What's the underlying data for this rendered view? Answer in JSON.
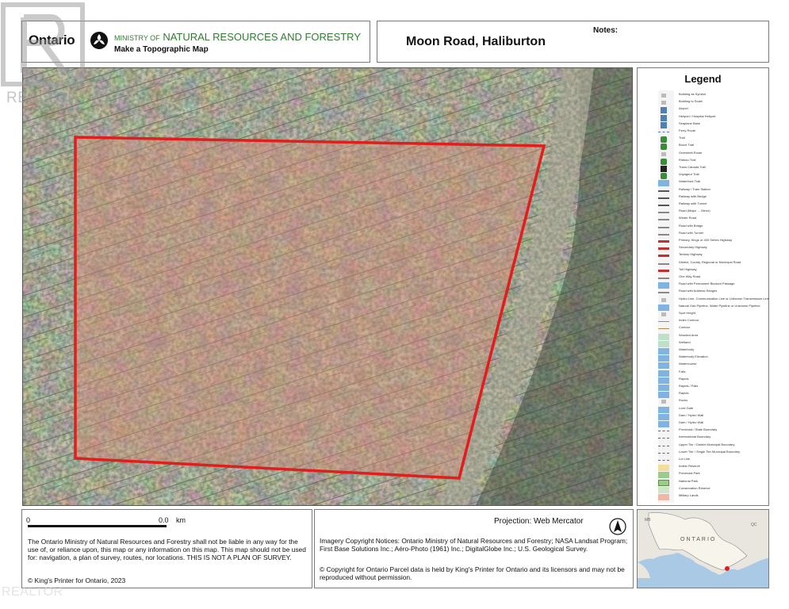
{
  "header": {
    "logo_text": "Ontario",
    "ministry_prefix": "MINISTRY OF",
    "ministry_name": "NATURAL RESOURCES AND FORESTRY",
    "subtitle": "Make a Topographic Map",
    "map_title": "Moon Road, Haliburton",
    "notes_label": "Notes:"
  },
  "legend": {
    "title": "Legend",
    "items": [
      "Building as Symbol",
      "Building to Scale",
      "Airport",
      "Heliport / Hospital Heliport",
      "Seaplane Base",
      "Ferry Route",
      "Trail",
      "Bruce Trail",
      "Greenbelt Route",
      "Rideau Trail",
      "Trans Canada Trail",
      "Voyageur Trail",
      "Waterfront Trail",
      "Railway / Train Station",
      "Railway with Bridge",
      "Railway with Tunnel",
      "Road (Major → Minor)",
      "Winter Road",
      "Road with Bridge",
      "Road with Tunnel",
      "Primary, Kings or 400 Series Highway",
      "Secondary Highway",
      "Tertiary Highway",
      "District, County, Regional or Municipal Road",
      "Toll Highway",
      "One Way Road",
      "Road with Permanent Blocked Passage",
      "Road with Address Ranges",
      "Hydro Line, Communication Line or Unknown Transmission Line",
      "Natural Gas Pipeline, Water Pipeline or Unknown Pipeline",
      "Spot Height",
      "Index Contour",
      "Contour",
      "Wooded Area",
      "Wetland",
      "Waterbody",
      "Waterbody Elevation",
      "Watercourse",
      "Falls",
      "Rapids",
      "Rapids / Falls",
      "Rapids",
      "Rocks",
      "Lock Gate",
      "Dam / Hydro Wall",
      "Dam / Hydro Wall",
      "Provincial / State Boundary",
      "International Boundary",
      "Upper Tier / District Municipal Boundary",
      "Lower Tier / Single Tier Municipal Boundary",
      "Lot Line",
      "Indian Reserve",
      "Provincial Park",
      "National Park",
      "Conservation Reserve",
      "Military Lands"
    ],
    "colors": {
      "water": "#7fb4e0",
      "park": "#9ccc8a",
      "reserve": "#f2dd9a",
      "military": "#f0b6a6",
      "trail_green": "#3a8c3a",
      "road_red": "#c03030"
    }
  },
  "footer": {
    "scale_start": "0",
    "scale_end": "0.0",
    "scale_unit": "km",
    "disclaimer": "The Ontario Ministry of Natural Resources and Forestry shall not be liable in any way for the use of, or reliance upon, this map or any information on this map.  This map should not be used for: navigation, a plan of survey, routes, nor locations. THIS IS NOT A PLAN OF SURVEY.",
    "copyright_kings": "© King's Printer for Ontario,  2023",
    "projection": "Projection: Web Mercator",
    "imagery_notice": "Imagery Copyright Notices: Ontario Ministry of Natural Resources and Forestry; NASA Landsat Program; First Base Solutions Inc.; Aéro-Photo (1961) Inc.; DigitalGlobe Inc.; U.S. Geological Survey.",
    "parcel_copyright": "© Copyright for Ontario Parcel data is held by King's Printer for Ontario and its licensors and may not be reproduced without permission.",
    "inset_province_label": "ONTARIO",
    "inset_west_label": "MB",
    "inset_east_label": "QC"
  },
  "map": {
    "parcel_outline_color": "#e01e1e",
    "imagery_tone": "#8a7f66"
  },
  "watermark": {
    "text": "REALTOR",
    "registered_mark": "®"
  }
}
